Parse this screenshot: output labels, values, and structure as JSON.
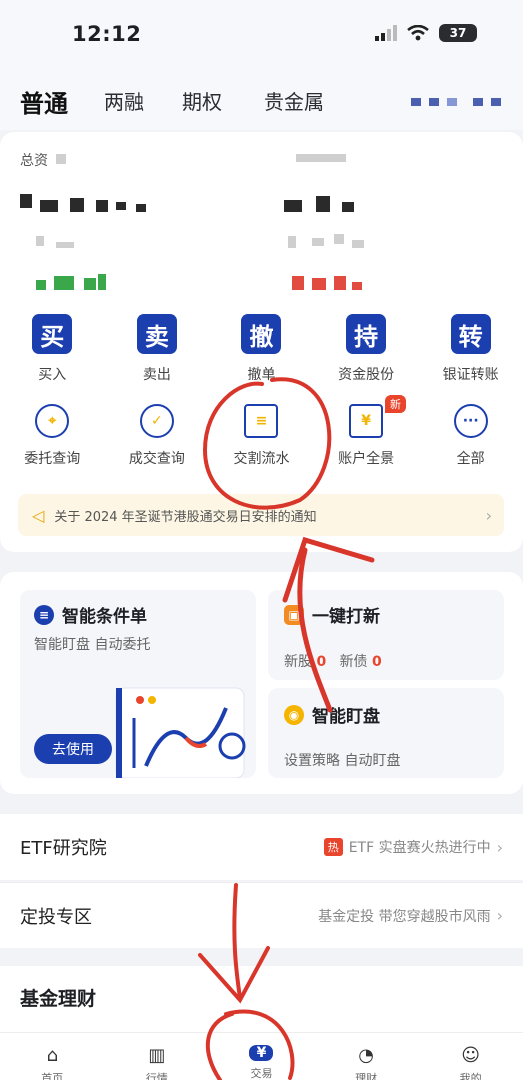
{
  "status": {
    "time": "12:12",
    "battery": "37"
  },
  "top_tabs": [
    {
      "label": "普通"
    },
    {
      "label": "两融"
    },
    {
      "label": "期权"
    },
    {
      "label": "贵金属"
    }
  ],
  "account": {
    "asset_label": "总资"
  },
  "trade_actions": [
    {
      "icon_char": "买",
      "label": "买入"
    },
    {
      "icon_char": "卖",
      "label": "卖出"
    },
    {
      "icon_char": "撤",
      "label": "撤单"
    },
    {
      "icon_char": "持",
      "label": "资金股份"
    },
    {
      "icon_char": "转",
      "label": "银证转账"
    }
  ],
  "tools": [
    {
      "label": "委托查询",
      "icon": "order-query-icon"
    },
    {
      "label": "成交查询",
      "icon": "deal-query-icon"
    },
    {
      "label": "交割流水",
      "icon": "delivery-icon"
    },
    {
      "label": "账户全景",
      "icon": "account-view-icon"
    },
    {
      "label": "全部",
      "icon": "more-icon"
    }
  ],
  "new_badge": "新",
  "notice": {
    "text": "关于 2024 年圣诞节港股通交易日安排的通知"
  },
  "smart_order": {
    "title": "智能条件单",
    "subtitle": "智能盯盘 自动委托",
    "button": "去使用"
  },
  "ipo": {
    "title": "一键打新",
    "new_stock_label": "新股",
    "new_stock_count": "0",
    "new_bond_label": "新债",
    "new_bond_count": "0"
  },
  "monitor": {
    "title": "智能盯盘",
    "subtitle": "设置策略 自动盯盘"
  },
  "etf_row": {
    "title": "ETF研究院",
    "badge": "热",
    "desc": "ETF 实盘赛火热进行中"
  },
  "dingtou_row": {
    "title": "定投专区",
    "desc": "基金定投 带您穿越股市风雨"
  },
  "fund_section": {
    "title": "基金理财"
  },
  "bottom_nav": [
    {
      "label": "首页",
      "icon": "home-icon"
    },
    {
      "label": "行情",
      "icon": "market-icon"
    },
    {
      "label": "交易",
      "icon": "trade-icon",
      "glyph": "¥"
    },
    {
      "label": "理财",
      "icon": "piggy-icon"
    },
    {
      "label": "我的",
      "icon": "profile-icon"
    }
  ],
  "colors": {
    "brand": "#1c3fb0",
    "annotation": "#d9362b",
    "up": "#e14b40",
    "down": "#3aa74a"
  }
}
